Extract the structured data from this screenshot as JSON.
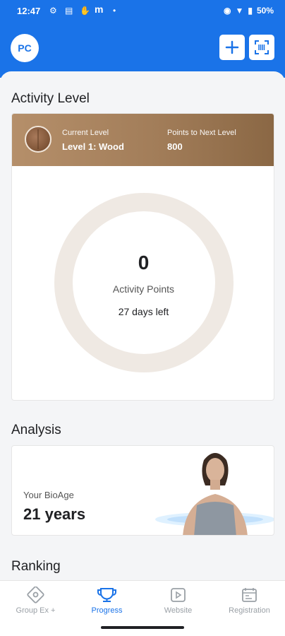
{
  "status_bar": {
    "time": "12:47",
    "battery": "50%"
  },
  "header": {
    "avatar_initials": "PC",
    "icons": [
      "plus-icon",
      "barcode-scan-icon"
    ]
  },
  "activity": {
    "title": "Activity Level",
    "current_level_label": "Current Level",
    "current_level_value": "Level 1: Wood",
    "points_next_label": "Points to Next Level",
    "points_next_value": "800",
    "points": "0",
    "points_label": "Activity Points",
    "days_left": "27 days left"
  },
  "analysis": {
    "title": "Analysis",
    "bioage_label": "Your BioAge",
    "bioage_value": "21 years"
  },
  "ranking": {
    "title": "Ranking"
  },
  "nav": {
    "items": [
      {
        "label": "Group Ex +",
        "icon": "target-icon"
      },
      {
        "label": "Progress",
        "icon": "trophy-icon"
      },
      {
        "label": "Website",
        "icon": "play-icon"
      },
      {
        "label": "Registration",
        "icon": "calendar-icon"
      }
    ],
    "active_index": 1
  },
  "colors": {
    "primary": "#1a73e8",
    "wood_gradient_start": "#b58f6a",
    "wood_gradient_end": "#8a6744",
    "ring": "#efe9e3"
  }
}
